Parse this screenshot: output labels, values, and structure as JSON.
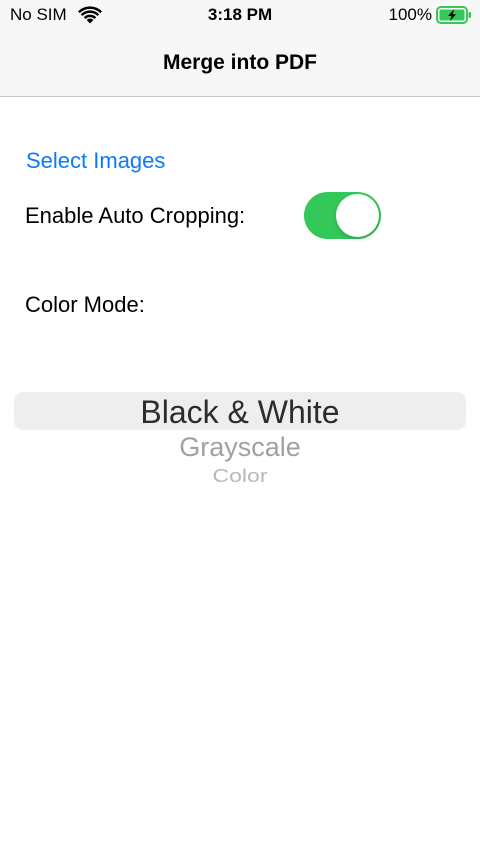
{
  "status_bar": {
    "carrier": "No SIM",
    "time": "3:18 PM",
    "battery_percent": "100%",
    "wifi_icon": "wifi-icon",
    "battery_icon": "battery-charging-icon"
  },
  "nav": {
    "title": "Merge into PDF"
  },
  "form": {
    "select_images_label": "Select Images",
    "auto_cropping_label": "Enable Auto Cropping:",
    "auto_cropping_enabled": true,
    "color_mode_label": "Color Mode:"
  },
  "picker": {
    "selected": "Black & White",
    "options": [
      "Black & White",
      "Grayscale",
      "Color"
    ]
  },
  "colors": {
    "accent": "#0a7aff",
    "toggle_on": "#34c759",
    "battery_green": "#34c759"
  }
}
